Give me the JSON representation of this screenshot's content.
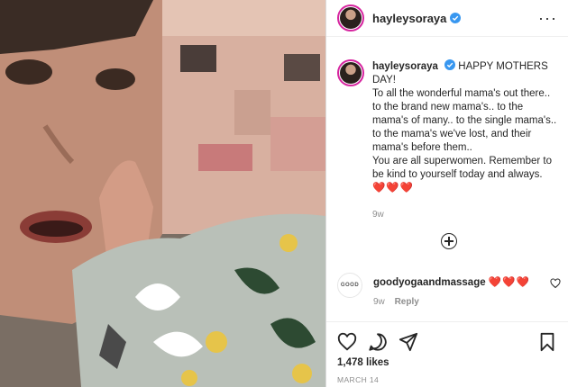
{
  "post": {
    "username": "hayleysoraya",
    "more_icon": "more-horizontal-icon",
    "caption_lines": [
      "HAPPY MOTHERS DAY!",
      "To all the wonderful mama's out there.. to the brand new mama's.. to the mama's of many.. to the single mama's.. to the mama's we've lost, and their mama's before them..",
      "You are all superwomen. Remember to be kind to yourself today and always."
    ],
    "caption_hearts": "❤️❤️❤️",
    "age": "9w",
    "load_more_icon": "add-circle-icon"
  },
  "comment": {
    "username": "goodyogaandmassage",
    "hearts": "❤️❤️❤️",
    "avatar_text": "GOOD",
    "age": "9w",
    "reply": "Reply"
  },
  "stats": {
    "likes": "1,478 likes",
    "date": "MARCH 14"
  },
  "colors": {
    "accent_blue": "#3897f0",
    "heart_red": "#e0245e",
    "muted": "#8e8e8e"
  }
}
